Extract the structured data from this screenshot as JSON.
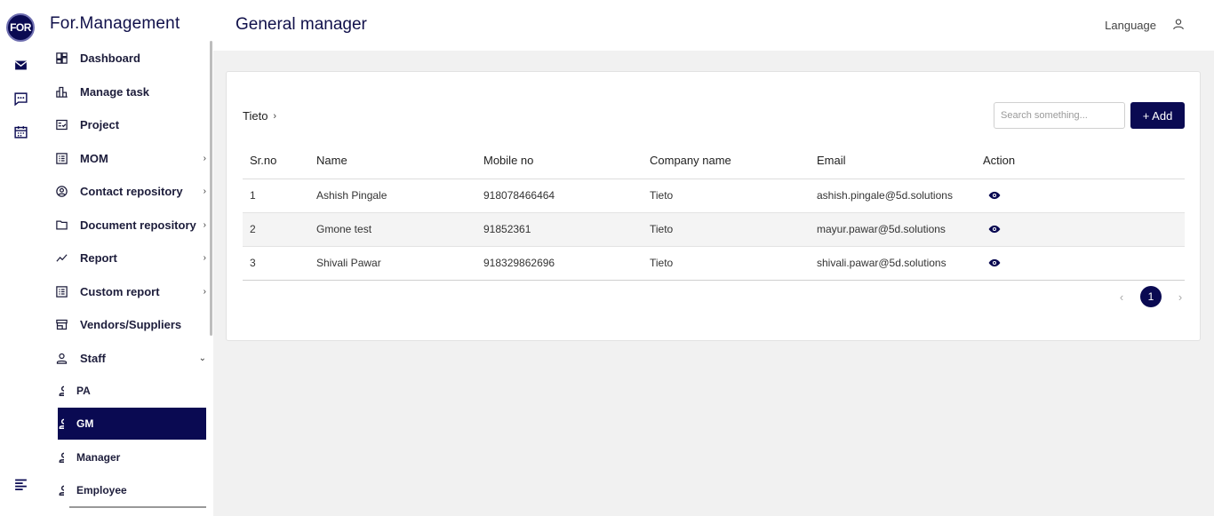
{
  "app": {
    "logo_text": "FOR",
    "brand": "For.Management",
    "page_title": "General manager",
    "language_label": "Language"
  },
  "rail": {
    "icons": [
      "mail-icon",
      "chat-icon",
      "calendar-icon",
      "menu-icon"
    ]
  },
  "sidebar": {
    "items": [
      {
        "label": "Dashboard",
        "icon": "dashboard-icon"
      },
      {
        "label": "Manage task",
        "icon": "bar-chart-icon"
      },
      {
        "label": "Project",
        "icon": "checklist-icon"
      },
      {
        "label": "MOM",
        "icon": "list-icon",
        "chevron": "›"
      },
      {
        "label": "Contact repository",
        "icon": "contact-icon",
        "chevron": "›"
      },
      {
        "label": "Document repository",
        "icon": "folder-icon",
        "chevron": "›"
      },
      {
        "label": "Report",
        "icon": "trend-icon",
        "chevron": "›"
      },
      {
        "label": "Custom report",
        "icon": "report-icon",
        "chevron": "›"
      },
      {
        "label": "Vendors/Suppliers",
        "icon": "store-icon"
      },
      {
        "label": "Staff",
        "icon": "person-icon",
        "chevron": "⌄"
      }
    ],
    "staff_sub": [
      {
        "label": "PA"
      },
      {
        "label": "GM",
        "active": true
      },
      {
        "label": "Manager"
      },
      {
        "label": "Employee"
      }
    ]
  },
  "main": {
    "breadcrumb": "Tieto",
    "breadcrumb_sep": "›",
    "search_placeholder": "Search something...",
    "add_label": "+ Add",
    "table": {
      "headers": [
        "Sr.no",
        "Name",
        "Mobile no",
        "Company name",
        "Email",
        "Action"
      ],
      "rows": [
        [
          "1",
          "Ashish Pingale",
          "918078466464",
          "Tieto",
          "ashish.pingale@5d.solutions"
        ],
        [
          "2",
          "Gmone test",
          "91852361",
          "Tieto",
          "mayur.pawar@5d.solutions"
        ],
        [
          "3",
          "Shivali Pawar",
          "918329862696",
          "Tieto",
          "shivali.pawar@5d.solutions"
        ]
      ]
    },
    "pagination": {
      "prev": "‹",
      "current": "1",
      "next": "›"
    }
  },
  "colors": {
    "primary": "#0a0a52",
    "content_bg": "#f1f1f1",
    "row_alt": "#f4f4f4"
  }
}
